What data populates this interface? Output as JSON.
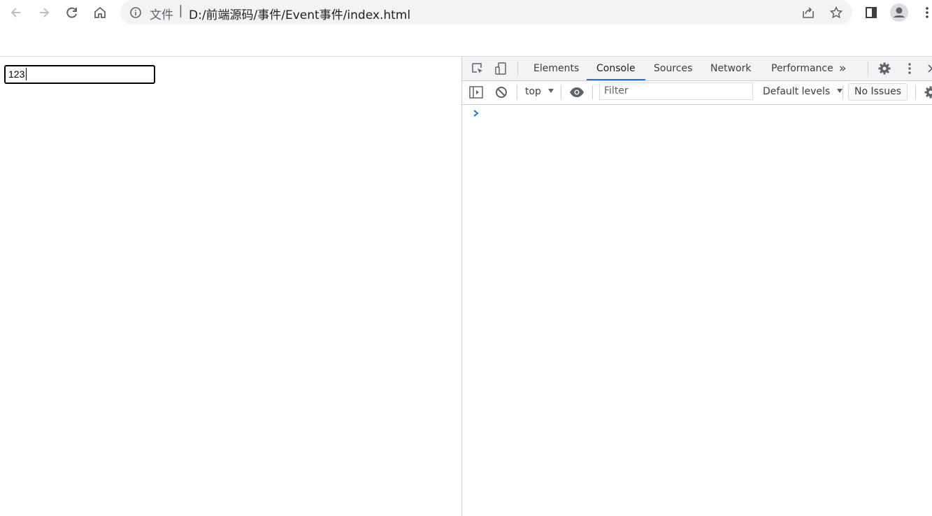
{
  "browser": {
    "omnibox": {
      "scheme_label": "文件",
      "separator": "|",
      "url": "D:/前端源码/事件/Event事件/index.html"
    },
    "icons": {
      "back": "arrow-left-icon",
      "forward": "arrow-right-icon",
      "reload": "reload-icon",
      "home": "home-icon",
      "info": "info-icon",
      "share": "share-icon",
      "bookmark": "star-icon",
      "side_panel": "side-panel-icon",
      "profile": "avatar-icon",
      "menu": "kebab-menu-icon"
    }
  },
  "page": {
    "input_value": "123"
  },
  "devtools": {
    "tabs": [
      {
        "label": "Elements",
        "active": false
      },
      {
        "label": "Console",
        "active": true
      },
      {
        "label": "Sources",
        "active": false
      },
      {
        "label": "Network",
        "active": false
      },
      {
        "label": "Performance",
        "active": false
      }
    ],
    "more_tabs": "»",
    "console": {
      "context": "top",
      "filter_placeholder": "Filter",
      "levels": "Default levels",
      "issues": "No Issues"
    },
    "colors": {
      "accent": "#1a73e8",
      "tabbar_bg": "#f1f3f4"
    }
  }
}
